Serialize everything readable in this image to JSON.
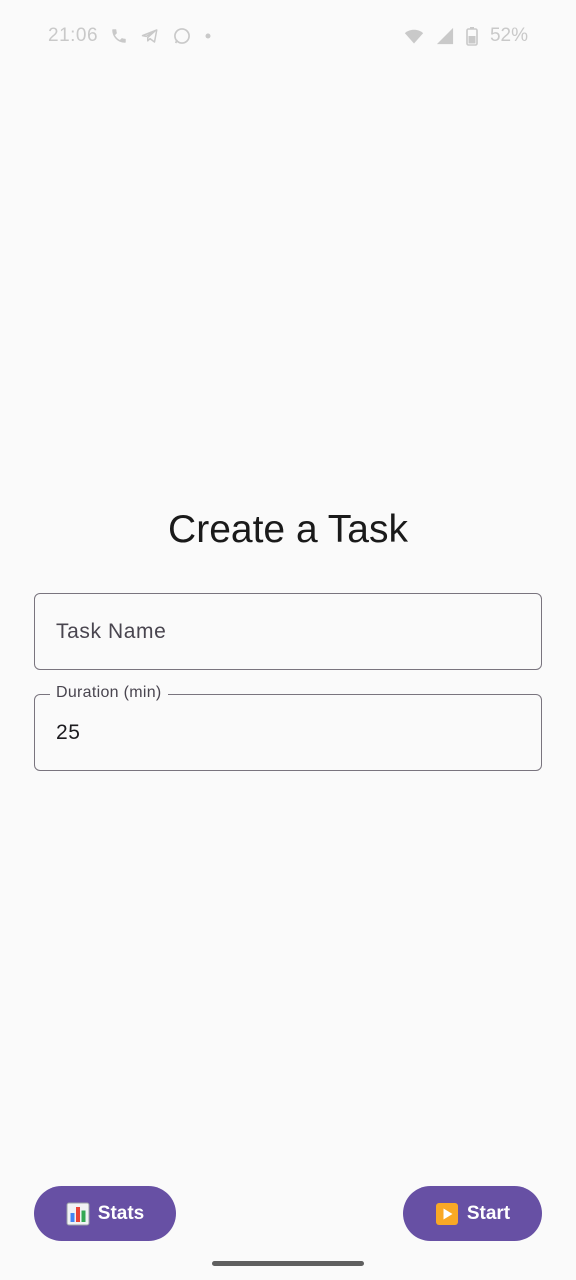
{
  "status_bar": {
    "time": "21:06",
    "battery": "52%",
    "icons_left": [
      "phone-icon",
      "telegram-icon",
      "whatsapp-icon",
      "dot-icon"
    ],
    "icons_right": [
      "wifi-icon",
      "signal-icon",
      "battery-icon"
    ]
  },
  "title": "Create a Task",
  "task_field": {
    "placeholder": "Task Name",
    "value": ""
  },
  "duration_field": {
    "label": "Duration (min)",
    "value": "25"
  },
  "buttons": {
    "stats_label": "Stats",
    "stats_icon": "bar-chart-icon",
    "start_label": "Start",
    "start_icon": "play-icon"
  },
  "colors": {
    "background": "#fafafa",
    "primary": "#6750a4",
    "outline": "#79747e",
    "text": "#1c1b1f",
    "label": "#49454f"
  }
}
